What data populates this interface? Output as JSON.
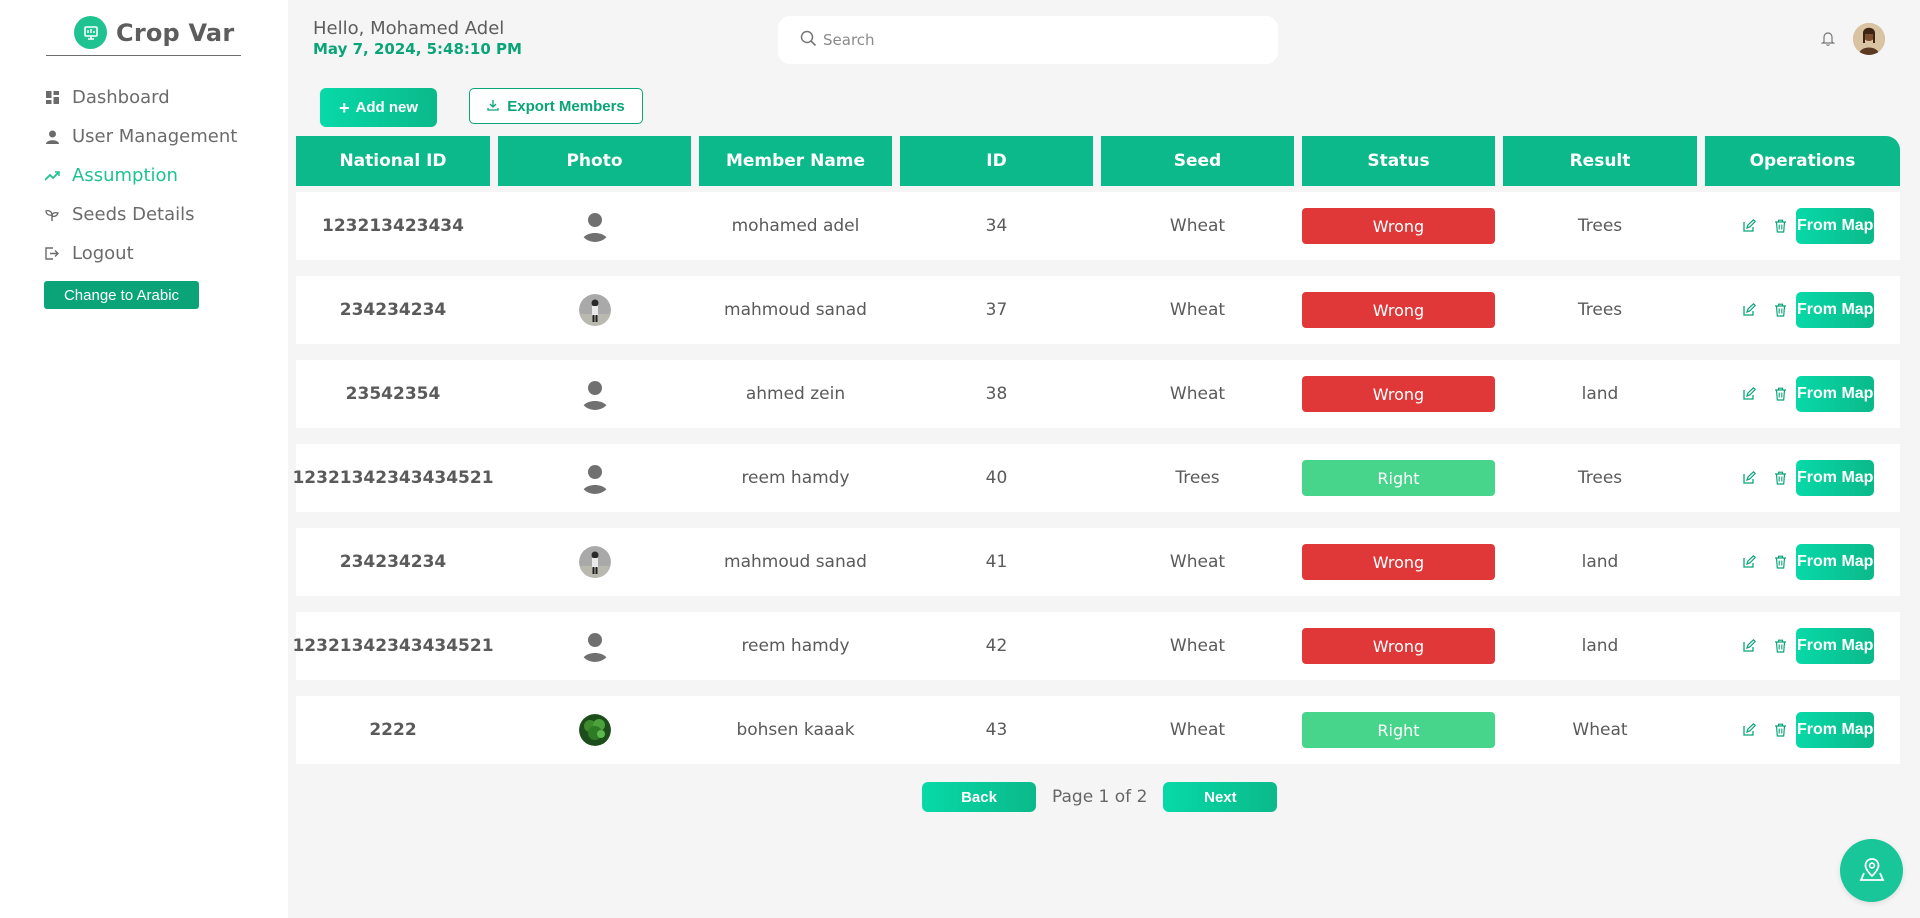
{
  "app": {
    "name": "Crop Var"
  },
  "sidebar": {
    "items": [
      {
        "label": "Dashboard",
        "icon": "dashboard-icon",
        "active": false
      },
      {
        "label": "User Management",
        "icon": "user-icon",
        "active": false
      },
      {
        "label": "Assumption",
        "icon": "trend-icon",
        "active": true
      },
      {
        "label": "Seeds Details",
        "icon": "sprout-icon",
        "active": false
      },
      {
        "label": "Logout",
        "icon": "logout-icon",
        "active": false
      }
    ],
    "language_button": "Change to Arabic"
  },
  "header": {
    "greeting": "Hello, Mohamed Adel",
    "datetime": "May 7, 2024, 5:48:10 PM",
    "search_placeholder": "Search"
  },
  "actions": {
    "add_label": "Add new",
    "export_label": "Export Members"
  },
  "table": {
    "columns": [
      "National ID",
      "Photo",
      "Member Name",
      "ID",
      "Seed",
      "Status",
      "Result",
      "Operations"
    ],
    "rows": [
      {
        "national_id": "123213423434",
        "photo": "default",
        "name": "mohamed adel",
        "id": "34",
        "seed": "Wheat",
        "status": "Wrong",
        "result": "Trees"
      },
      {
        "national_id": "234234234",
        "photo": "person",
        "name": "mahmoud sanad",
        "id": "37",
        "seed": "Wheat",
        "status": "Wrong",
        "result": "Trees"
      },
      {
        "national_id": "23542354",
        "photo": "default",
        "name": "ahmed zein",
        "id": "38",
        "seed": "Wheat",
        "status": "Wrong",
        "result": "land"
      },
      {
        "national_id": "12321342343434521",
        "photo": "default",
        "name": "reem hamdy",
        "id": "40",
        "seed": "Trees",
        "status": "Right",
        "result": "Trees"
      },
      {
        "national_id": "234234234",
        "photo": "person",
        "name": "mahmoud sanad",
        "id": "41",
        "seed": "Wheat",
        "status": "Wrong",
        "result": "land"
      },
      {
        "national_id": "12321342343434521",
        "photo": "default",
        "name": "reem hamdy",
        "id": "42",
        "seed": "Wheat",
        "status": "Wrong",
        "result": "land"
      },
      {
        "national_id": "2222",
        "photo": "plant",
        "name": "bohsen kaaak",
        "id": "43",
        "seed": "Wheat",
        "status": "Right",
        "result": "Wheat"
      }
    ],
    "map_button_label": "From Map"
  },
  "pagination": {
    "back_label": "Back",
    "page_text": "Page 1 of 2",
    "next_label": "Next"
  },
  "colors": {
    "primary": "#0bb98a",
    "wrong": "#e03838",
    "right": "#46d58a"
  }
}
